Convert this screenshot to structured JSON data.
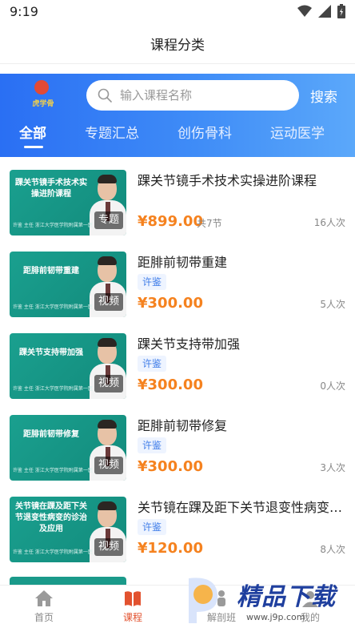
{
  "status_bar": {
    "time": "9:19",
    "icons": [
      "wifi-icon",
      "signal-icon",
      "battery-icon"
    ]
  },
  "header": {
    "title": "课程分类"
  },
  "logo": {
    "text": "虎学骨"
  },
  "search": {
    "placeholder": "输入课程名称",
    "button_label": "搜索"
  },
  "tabs": [
    {
      "label": "全部",
      "active": true
    },
    {
      "label": "专题汇总",
      "active": false
    },
    {
      "label": "创伤骨科",
      "active": false
    },
    {
      "label": "运动医学",
      "active": false
    }
  ],
  "courses": [
    {
      "title": "踝关节镜手术技术实操进阶课程",
      "thumb_title": "踝关节镜手术技术实操进阶课程",
      "thumb_caption": "许鉴 主任 浙江大学医学院附属第一医院",
      "badge": "专题",
      "tag": "",
      "price": "¥899.00",
      "lessons": "共7节",
      "views": "16人次"
    },
    {
      "title": "距腓前韧带重建",
      "thumb_title": "距腓前韧带重建",
      "thumb_caption": "许鉴 主任 浙江大学医学院附属第一医院",
      "badge": "视频",
      "tag": "许鉴",
      "price": "¥300.00",
      "lessons": "",
      "views": "5人次"
    },
    {
      "title": "踝关节支持带加强",
      "thumb_title": "踝关节支持带加强",
      "thumb_caption": "许鉴 主任 浙江大学医学院附属第一医院",
      "badge": "视频",
      "tag": "许鉴",
      "price": "¥300.00",
      "lessons": "",
      "views": "0人次"
    },
    {
      "title": "距腓前韧带修复",
      "thumb_title": "距腓前韧带修复",
      "thumb_caption": "许鉴 主任 浙江大学医学院附属第一医院",
      "badge": "视频",
      "tag": "许鉴",
      "price": "¥300.00",
      "lessons": "",
      "views": "3人次"
    },
    {
      "title": "关节镜在踝及距下关节退变性病变的诊治及应用",
      "thumb_title": "关节镜在踝及距下关节退变性病变的诊治及应用",
      "thumb_caption": "许鉴 主任 浙江大学医学院附属第一医院",
      "badge": "视频",
      "tag": "许鉴",
      "price": "¥120.00",
      "lessons": "",
      "views": "8人次"
    }
  ],
  "bottom_nav": [
    {
      "label": "首页",
      "icon": "home-icon",
      "active": false
    },
    {
      "label": "课程",
      "icon": "book-icon",
      "active": true
    },
    {
      "label": "解剖班",
      "icon": "anatomy-icon",
      "active": false
    },
    {
      "label": "我的",
      "icon": "profile-icon",
      "active": false
    }
  ],
  "watermark": {
    "text": "精品下载",
    "url": "www.j9p.com"
  },
  "colors": {
    "accent_blue": "#3a86f5",
    "price_orange": "#f5821f",
    "tab_active_red": "#e2522f",
    "thumb_teal": "#1aa08f"
  }
}
